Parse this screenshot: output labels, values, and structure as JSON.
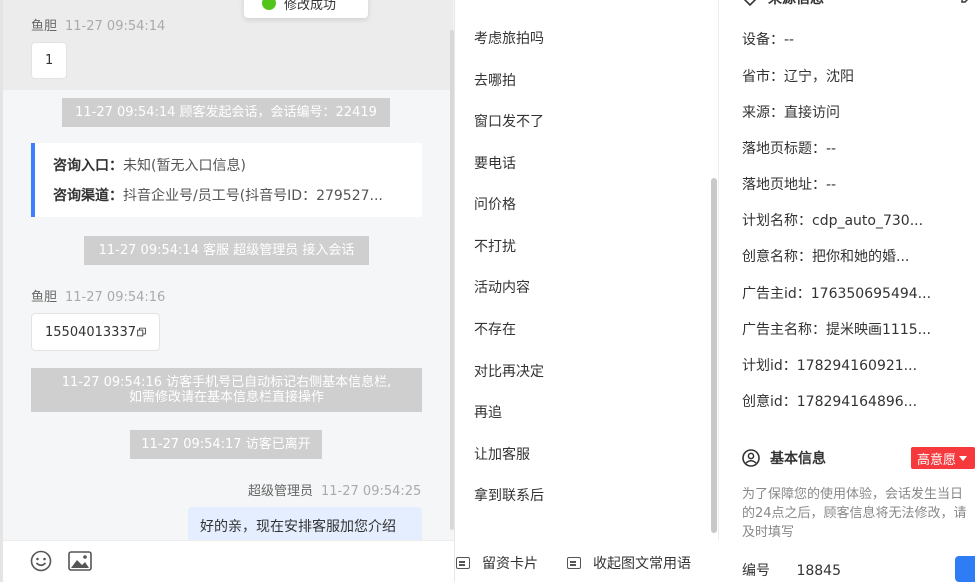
{
  "toast": {
    "text": "修改成功"
  },
  "chat": {
    "msg1": {
      "sender": "鱼胆",
      "time": "11-27 09:54:14",
      "text": "1"
    },
    "sys1": "11-27 09:54:14 顾客发起会话，会话编号：22419",
    "card": {
      "entry_label": "咨询入口：",
      "entry_value": "未知(暂无入口信息)",
      "channel_label": "咨询渠道：",
      "channel_value": "抖音企业号/员工号(抖音号ID：279527..."
    },
    "sys2": "11-27 09:54:14 客服 超级管理员 接入会话",
    "msg2": {
      "sender": "鱼胆",
      "time": "11-27 09:54:16",
      "text": "15504013337"
    },
    "sys3_line1": "11-27 09:54:16 访客手机号已自动标记右侧基本信息栏,",
    "sys3_line2": "如需修改请在基本信息栏直接操作",
    "sys4": "11-27 09:54:17 访客已离开",
    "msg3": {
      "sender": "超级管理员",
      "time": "11-27 09:54:25",
      "text": "好的亲，现在安排客服加您介绍"
    }
  },
  "quick_replies": {
    "items": [
      "考虑旅拍吗",
      "去哪拍",
      "窗口发不了",
      "要电话",
      "问价格",
      "不打扰",
      "活动内容",
      "不存在",
      "对比再决定",
      "再追",
      "让加客服",
      "拿到联系后"
    ],
    "card_button": "留资卡片",
    "collapse_button": "收起图文常用语"
  },
  "info": {
    "source_title": "来源信息",
    "fields": [
      "设备：--",
      "省市：辽宁，沈阳",
      "来源：直接访问",
      "落地页标题：--",
      "落地页地址：--",
      "计划名称：cdp_auto_730...",
      "创意名称：把你和她的婚...",
      "广告主id：176350695494...",
      "广告主名称：提米映画1115...",
      "计划id：178294160921...",
      "创意id：178294164896..."
    ],
    "basic_title": "基本信息",
    "intent_tag": "高意愿",
    "notice": "为了保障您的使用体验，会话发生当日的24点之后，顾客信息将无法修改，请及时填写",
    "id_label": "编号",
    "id_value": "18845"
  },
  "colors": {
    "accent": "#3d7eff",
    "tag": "#f5393d",
    "system_msg": "#cfcfcf",
    "agent_bubble": "#e4eefe"
  }
}
